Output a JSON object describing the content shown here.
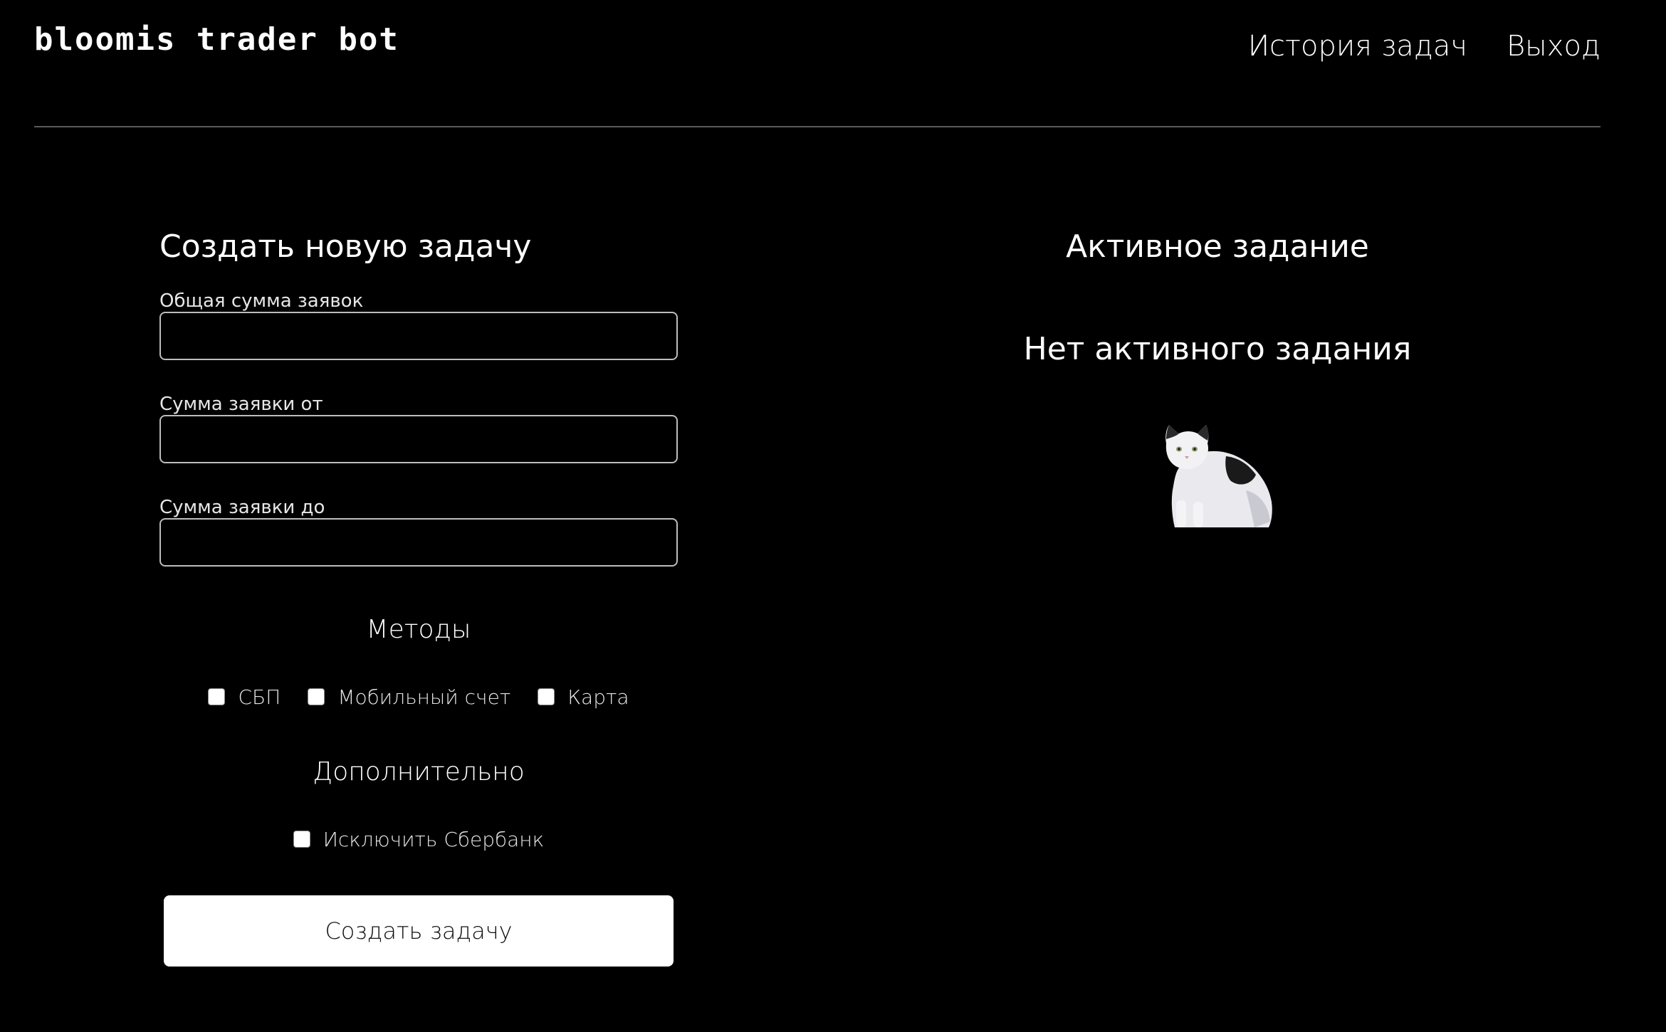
{
  "app": {
    "logo": "bloomis trader bot"
  },
  "nav": {
    "history": "История задач",
    "logout": "Выход"
  },
  "form": {
    "title": "Создать новую задачу",
    "total_label": "Общая сумма заявок",
    "total_value": "",
    "min_label": "Сумма заявки от",
    "min_value": "",
    "max_label": "Сумма заявки до",
    "max_value": "",
    "methods_title": "Методы",
    "methods": [
      {
        "label": "СБП",
        "checked": false
      },
      {
        "label": "Мобильный счет",
        "checked": false
      },
      {
        "label": "Карта",
        "checked": false
      }
    ],
    "extra_title": "Дополнительно",
    "exclude_sber_label": "Исключить Сбербанк",
    "exclude_sber_checked": false,
    "submit_label": "Создать задачу"
  },
  "active": {
    "title": "Активное задание",
    "empty_text": "Нет активного задания"
  },
  "colors": {
    "background": "#000000",
    "text": "#ffffff",
    "button_bg": "#ffffff",
    "divider": "#5a5a5a"
  }
}
